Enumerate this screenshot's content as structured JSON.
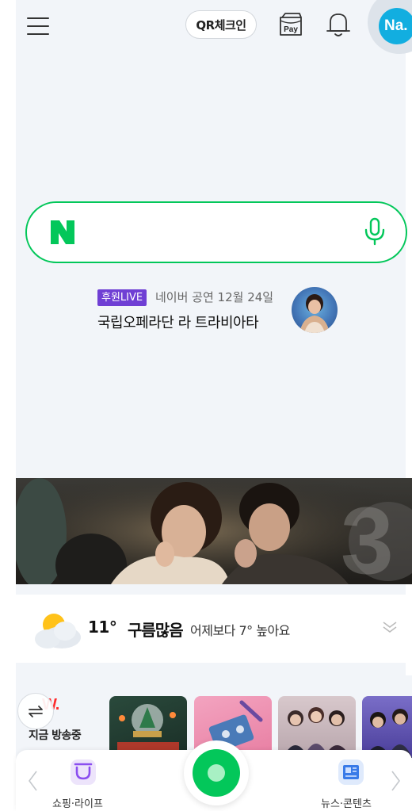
{
  "header": {
    "qr_checkin": "QR체크인",
    "pay": "Pay",
    "avatar": "Na."
  },
  "search": {
    "logo": "N"
  },
  "sponsored": {
    "badge": "후원LIVE",
    "subtitle": "네이버 공연 12월 24일",
    "title": "국립오페라단 라 트라비아타"
  },
  "weather": {
    "temperature": "11°",
    "condition": "구름많음",
    "comparison": "어제보다 7° 높아요"
  },
  "live": {
    "logo": "W.",
    "label": "지금 방송중"
  },
  "bottom_nav": {
    "left_label": "쇼핑·라이프",
    "right_label": "뉴스·콘텐츠"
  },
  "colors": {
    "naver_green": "#03c75a",
    "badge_purple": "#6f3fd4",
    "avatar_blue": "#12aee0",
    "live_red": "#ff2a2a"
  },
  "icons": [
    "menu-icon",
    "pay-icon",
    "bell-icon",
    "naver-logo",
    "mic-icon",
    "weather-cloud-sun-icon",
    "chevron-down-icon",
    "refresh-icon",
    "shopping-icon",
    "news-icon",
    "chevron-left-icon",
    "chevron-right-icon"
  ]
}
